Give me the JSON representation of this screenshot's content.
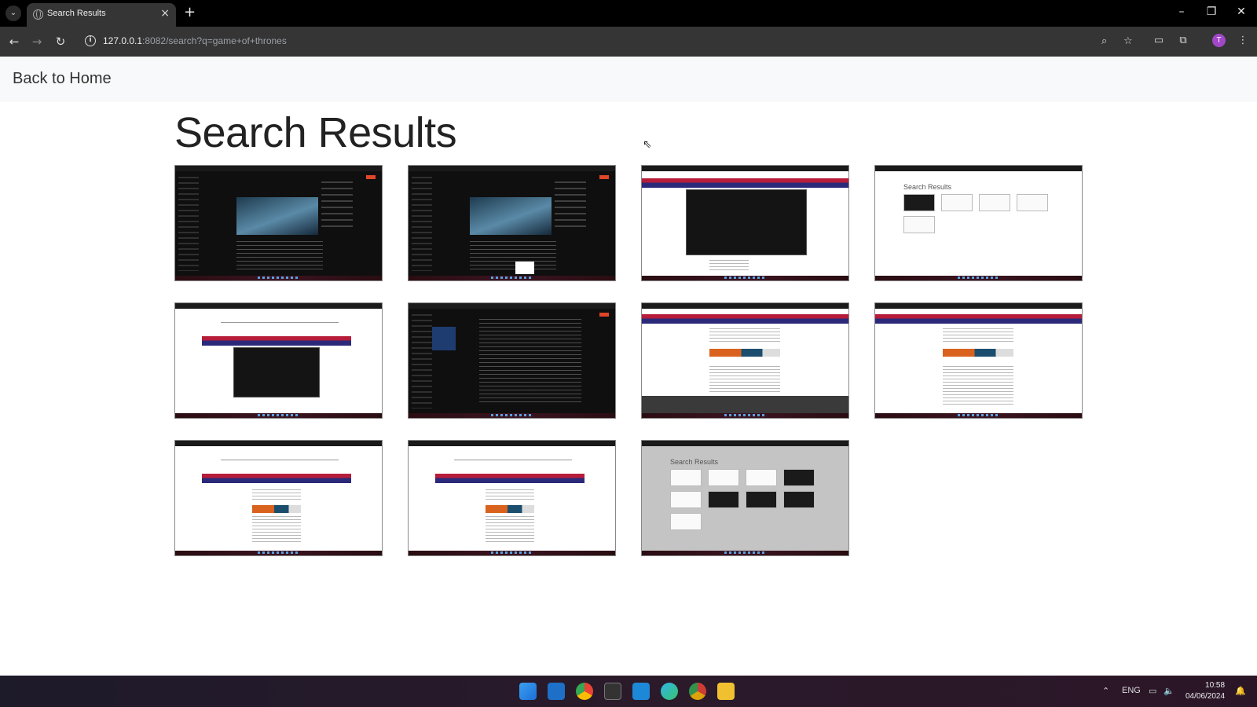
{
  "browser": {
    "tab_title": "Search Results",
    "url_host": "127.0.0.1",
    "url_rest": ":8082/search?q=game+of+thrones",
    "avatar_letter": "T"
  },
  "page": {
    "back_link": "Back to Home",
    "title": "Search Results",
    "results": [
      {
        "kind": "video-dark"
      },
      {
        "kind": "video-dark"
      },
      {
        "kind": "bbc-dark-window"
      },
      {
        "kind": "search-results-page"
      },
      {
        "kind": "search-bbc-dark-window"
      },
      {
        "kind": "dark-editor"
      },
      {
        "kind": "bbc-article-footer"
      },
      {
        "kind": "bbc-article"
      },
      {
        "kind": "search-bbc-article"
      },
      {
        "kind": "search-bbc-article"
      },
      {
        "kind": "search-results-page-grey"
      }
    ]
  },
  "taskbar": {
    "language": "ENG",
    "time": "10:58",
    "date": "04/06/2024"
  },
  "colors": {
    "chrome_bg": "#000000",
    "toolbar_bg": "#353535",
    "avatar": "#a147c8",
    "topbar_bg": "#f8f9fa"
  }
}
